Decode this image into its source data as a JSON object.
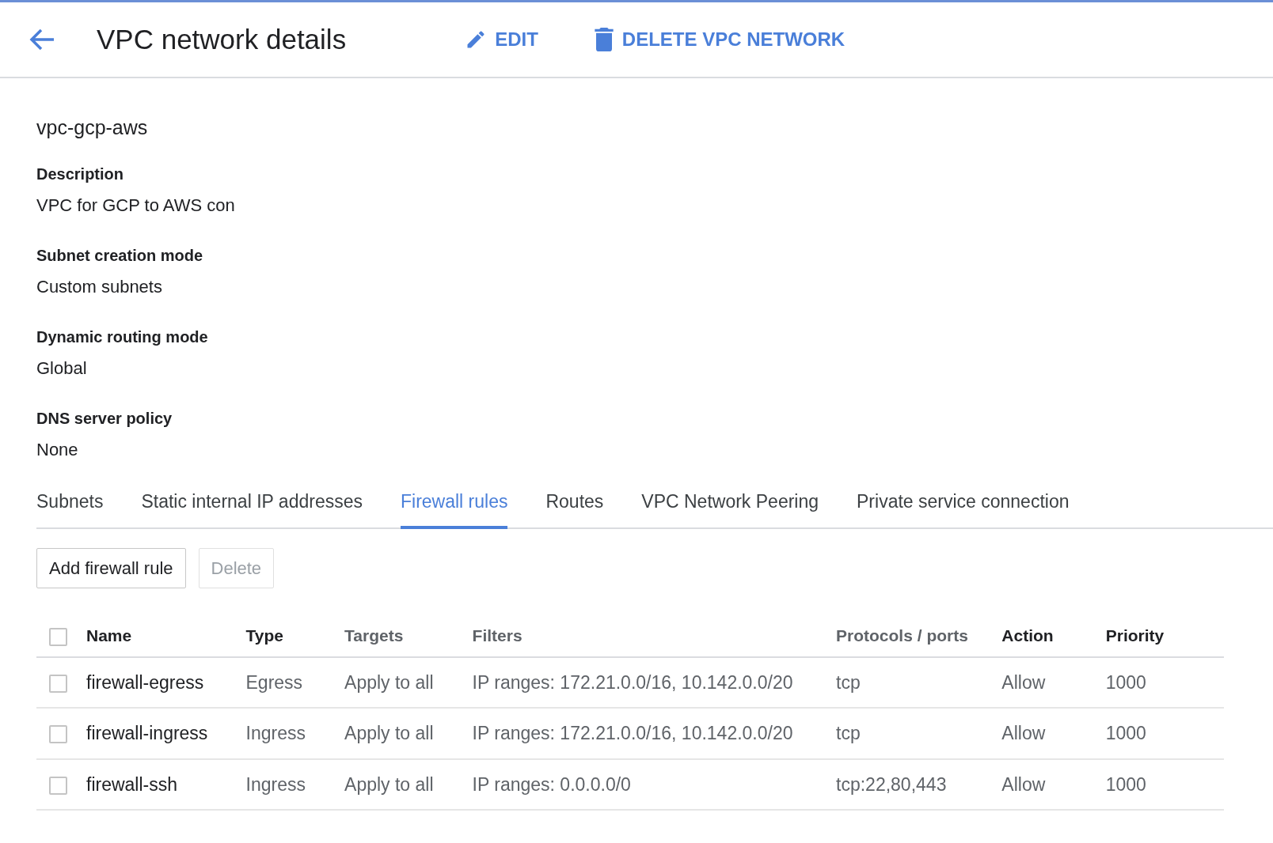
{
  "header": {
    "title": "VPC network details",
    "actions": [
      {
        "kind": "edit",
        "label": "EDIT"
      },
      {
        "kind": "delete",
        "label": "DELETE VPC NETWORK"
      }
    ]
  },
  "network_name": "vpc-gcp-aws",
  "properties": [
    {
      "label": "Description",
      "value": "VPC for GCP to AWS con"
    },
    {
      "label": "Subnet creation mode",
      "value": "Custom subnets"
    },
    {
      "label": "Dynamic routing mode",
      "value": "Global"
    },
    {
      "label": "DNS server policy",
      "value": "None"
    }
  ],
  "tabs": [
    {
      "label": "Subnets",
      "selected": false
    },
    {
      "label": "Static internal IP addresses",
      "selected": false
    },
    {
      "label": "Firewall rules",
      "selected": true
    },
    {
      "label": "Routes",
      "selected": false
    },
    {
      "label": "VPC Network Peering",
      "selected": false
    },
    {
      "label": "Private service connection",
      "selected": false
    }
  ],
  "buttons": [
    {
      "label": "Add firewall rule",
      "disabled": false
    },
    {
      "label": "Delete",
      "disabled": true
    }
  ],
  "table": {
    "select_all_checked": false,
    "columns": [
      {
        "label": "Name",
        "dimmed": false
      },
      {
        "label": "Type",
        "dimmed": false
      },
      {
        "label": "Targets",
        "dimmed": true
      },
      {
        "label": "Filters",
        "dimmed": true
      },
      {
        "label": "Protocols / ports",
        "dimmed": true
      },
      {
        "label": "Action",
        "dimmed": false
      },
      {
        "label": "Priority",
        "dimmed": false
      }
    ],
    "rows": [
      {
        "checked": false,
        "cells": [
          "firewall-egress",
          "Egress",
          "Apply to all",
          "IP ranges: 172.21.0.0/16, 10.142.0.0/20",
          "tcp",
          "Allow",
          "1000"
        ]
      },
      {
        "checked": false,
        "cells": [
          "firewall-ingress",
          "Ingress",
          "Apply to all",
          "IP ranges: 172.21.0.0/16, 10.142.0.0/20",
          "tcp",
          "Allow",
          "1000"
        ]
      },
      {
        "checked": false,
        "cells": [
          "firewall-ssh",
          "Ingress",
          "Apply to all",
          "IP ranges: 0.0.0.0/0",
          "tcp:22,80,443",
          "Allow",
          "1000"
        ]
      }
    ]
  }
}
